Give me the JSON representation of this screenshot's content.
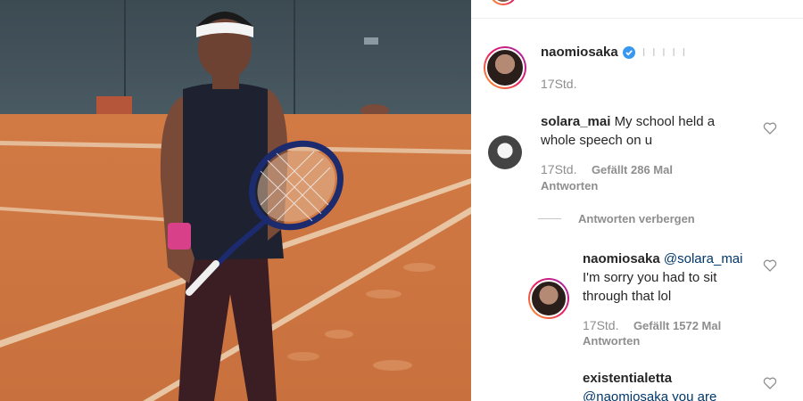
{
  "post": {
    "author": "naomiosaka",
    "subtitle_blur": "I I I I I",
    "time": "17Std."
  },
  "comments": [
    {
      "user": "solara_mai",
      "text_line1": "My school held a",
      "text_line2": "whole speech on u",
      "time": "17Std.",
      "likes": "Gefällt 286 Mal",
      "reply": "Antworten",
      "hide_replies": "Antworten verbergen"
    }
  ],
  "replies": [
    {
      "user": "naomiosaka",
      "mention": "@solara_mai",
      "text_line1": "I'm sorry you had to sit",
      "text_line2": "through that lol",
      "time": "17Std.",
      "likes": "Gefällt 1572 Mal",
      "reply": "Antworten"
    },
    {
      "user": "existentialetta",
      "partial_text": "@naomiosaka you are"
    }
  ],
  "colors": {
    "clay": "#c8703c",
    "verified": "#3897f0",
    "text": "#262626",
    "muted": "#8e8e8e"
  }
}
